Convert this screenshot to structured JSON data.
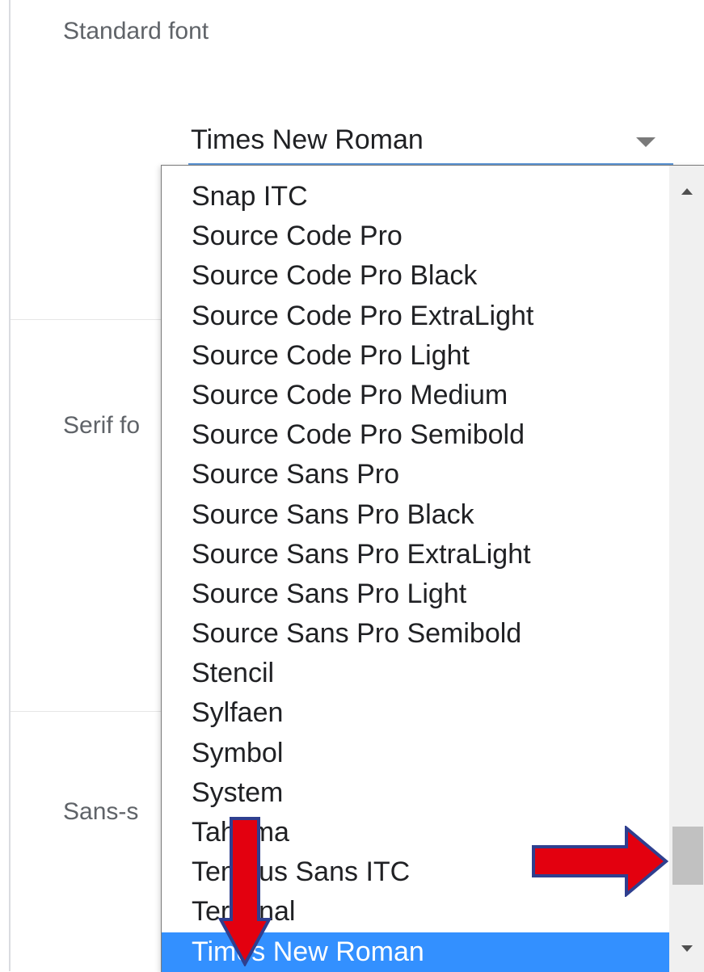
{
  "sections": {
    "standard_label": "Standard font",
    "serif_label": "Serif fo",
    "sans_label": "Sans-s"
  },
  "select": {
    "value": "Times New Roman"
  },
  "dropdown": {
    "options": [
      "Snap ITC",
      "Source Code Pro",
      "Source Code Pro Black",
      "Source Code Pro ExtraLight",
      "Source Code Pro Light",
      "Source Code Pro Medium",
      "Source Code Pro Semibold",
      "Source Sans Pro",
      "Source Sans Pro Black",
      "Source Sans Pro ExtraLight",
      "Source Sans Pro Light",
      "Source Sans Pro Semibold",
      "Stencil",
      "Sylfaen",
      "Symbol",
      "System",
      "Tahoma",
      "Tempus Sans ITC",
      "Terminal",
      "Times New Roman"
    ],
    "selected_index": 19
  },
  "colors": {
    "selected_bg": "#3390ff",
    "selected_text": "#ffffff",
    "annotation_fill": "#e3000f",
    "annotation_outline": "#2f3f8f",
    "underline": "#5b95d6"
  },
  "icons": {
    "select_caret": "caret-down-icon",
    "scroll_up": "arrow-up-icon",
    "scroll_down": "arrow-down-icon",
    "annotation_right": "red-arrow-right-icon",
    "annotation_down": "red-arrow-down-icon"
  }
}
